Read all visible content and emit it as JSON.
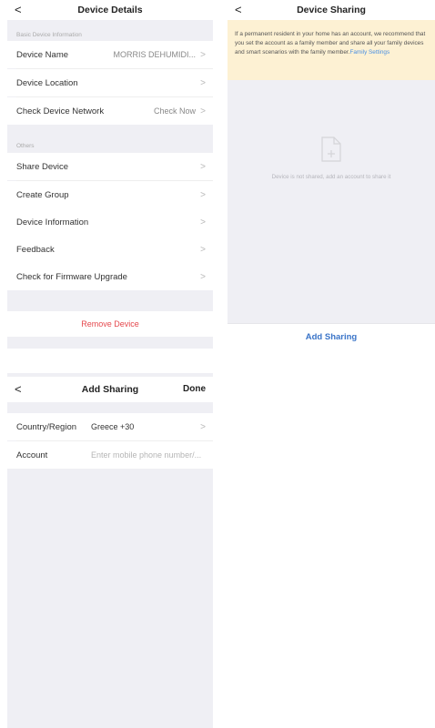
{
  "device_details": {
    "back_glyph": "<",
    "title": "Device Details",
    "section_basic": "Basic Device Information",
    "device_name_label": "Device Name",
    "device_name_value": "MORRIS DEHUMIDI...",
    "device_location_label": "Device Location",
    "check_network_label": "Check Device Network",
    "check_network_value": "Check Now",
    "section_others": "Others",
    "share_device_label": "Share Device",
    "create_group_label": "Create Group",
    "device_information_label": "Device Information",
    "feedback_label": "Feedback",
    "firmware_label": "Check for Firmware Upgrade",
    "remove_device_label": "Remove Device",
    "chevron_glyph": ">"
  },
  "device_sharing": {
    "back_glyph": "<",
    "title": "Device Sharing",
    "notice_text": "If a permanent resident in your home has an account, we recommend that you set the account as a family member and share all your family devices and smart scenarios with the family member.",
    "family_settings_link": "Family Settings",
    "empty_text": "Device is not shared, add an account to share it",
    "add_sharing_button": "Add Sharing"
  },
  "add_sharing": {
    "back_glyph": "<",
    "title": "Add Sharing",
    "done_label": "Done",
    "country_label": "Country/Region",
    "country_value": "Greece +30",
    "account_label": "Account",
    "account_placeholder": "Enter mobile phone number/...",
    "chevron_glyph": ">"
  },
  "colors": {
    "page_gray": "#efeff4",
    "notice_bg": "#fdf1d3",
    "link_blue": "#4a90e2",
    "remove_red": "#e5484d",
    "add_sharing_blue": "#3a74c8"
  }
}
